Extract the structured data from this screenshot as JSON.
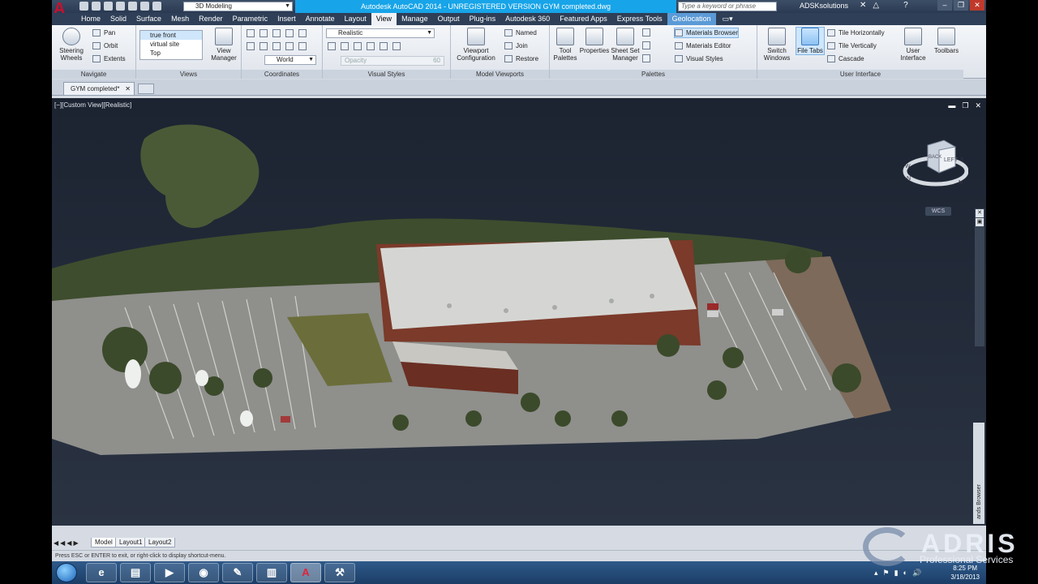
{
  "titlebar": {
    "workspace": "3D Modeling",
    "title": "Autodesk AutoCAD 2014 - UNREGISTERED VERSION   GYM completed.dwg",
    "search_placeholder": "Type a keyword or phrase",
    "user": "ADSKsolutions"
  },
  "tabs": [
    "Home",
    "Solid",
    "Surface",
    "Mesh",
    "Render",
    "Parametric",
    "Insert",
    "Annotate",
    "Layout",
    "View",
    "Manage",
    "Output",
    "Plug-ins",
    "Autodesk 360",
    "Featured Apps",
    "Express Tools",
    "Geolocation"
  ],
  "ribbon": {
    "navigate": {
      "title": "Navigate",
      "steering_wheels": "Steering Wheels",
      "pan": "Pan",
      "orbit": "Orbit",
      "extents": "Extents"
    },
    "views": {
      "title": "Views",
      "items": [
        "true front",
        "virtual site",
        "Top"
      ],
      "view_manager": "View Manager"
    },
    "coordinates": {
      "title": "Coordinates",
      "world": "World"
    },
    "visual_styles": {
      "title": "Visual Styles",
      "current": "Realistic",
      "opacity_placeholder": "Opacity",
      "opacity_value": "60"
    },
    "model_viewports": {
      "title": "Model Viewports",
      "viewport_config": "Viewport Configuration",
      "named": "Named",
      "join": "Join",
      "restore": "Restore"
    },
    "palettes": {
      "title": "Palettes",
      "tool_palettes": "Tool Palettes",
      "properties": "Properties",
      "sheet_set_manager": "Sheet Set Manager",
      "materials_browser": "Materials Browser",
      "materials_editor": "Materials Editor",
      "visual_styles": "Visual Styles"
    },
    "user_interface": {
      "title": "User Interface",
      "switch_windows": "Switch Windows",
      "file_tabs": "File Tabs",
      "tile_horizontally": "Tile Horizontally",
      "tile_vertically": "Tile Vertically",
      "cascade": "Cascade",
      "user_interface": "User Interface",
      "toolbars": "Toolbars"
    }
  },
  "file_tab": "GYM completed*",
  "viewport": {
    "label": "[−][Custom View][Realistic]",
    "cube_face": "LEFT",
    "cube_back": "BACK",
    "compass_s": "S",
    "compass_n": "N",
    "compass_w": "W",
    "compass_m": "M",
    "wcs": "WCS",
    "palette_strip": "ands Browser"
  },
  "layout_tabs": [
    "Model",
    "Layout1",
    "Layout2"
  ],
  "status_text": "Press ESC or ENTER to exit, or right-click to display shortcut-menu.",
  "clock": {
    "time": "8:25 PM",
    "date": "3/18/2013"
  },
  "watermark": {
    "brand": "ADRIS",
    "sub": "Professional Services"
  },
  "colors": {
    "title_highlight": "#17a4e8",
    "geolocation_tab": "#5b9ad6",
    "viewport_bg": "#1f2733"
  }
}
